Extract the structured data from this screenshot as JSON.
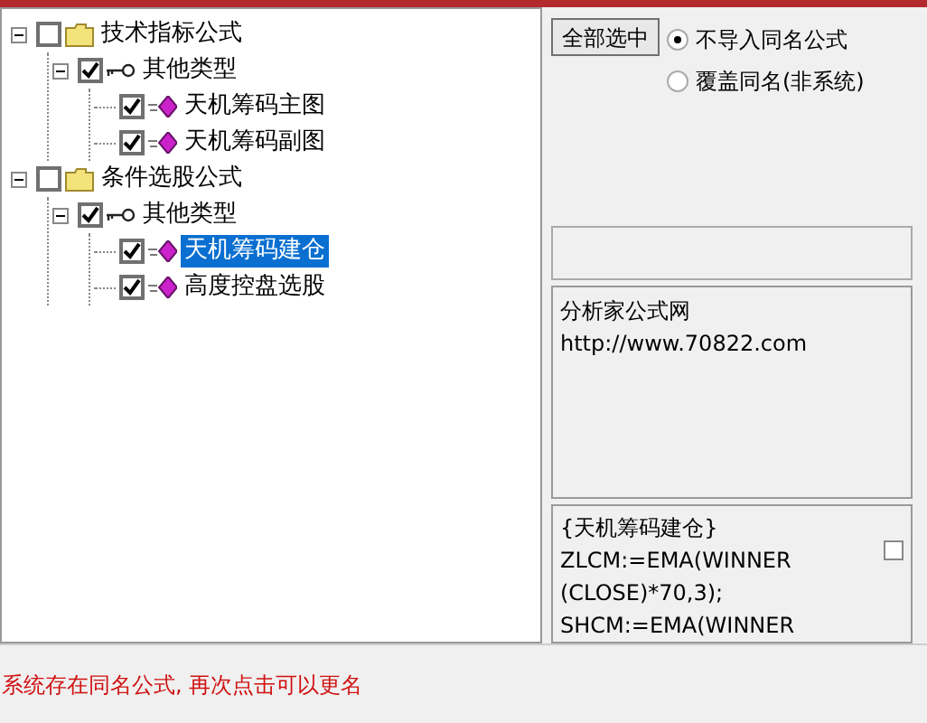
{
  "tree": [
    {
      "kind": "folder",
      "label": "技术指标公式",
      "checked": false,
      "selected": false,
      "expanded": true,
      "children": [
        {
          "kind": "group",
          "label": "其他类型",
          "checked": true,
          "selected": false,
          "expanded": true,
          "children": [
            {
              "kind": "formula",
              "label": "天机筹码主图",
              "checked": true,
              "selected": false
            },
            {
              "kind": "formula",
              "label": "天机筹码副图",
              "checked": true,
              "selected": false
            }
          ]
        }
      ]
    },
    {
      "kind": "folder",
      "label": "条件选股公式",
      "checked": false,
      "selected": false,
      "expanded": true,
      "children": [
        {
          "kind": "group",
          "label": "其他类型",
          "checked": true,
          "selected": false,
          "expanded": true,
          "children": [
            {
              "kind": "formula",
              "label": "天机筹码建仓",
              "checked": true,
              "selected": true
            },
            {
              "kind": "formula",
              "label": "高度控盘选股",
              "checked": true,
              "selected": false
            }
          ]
        }
      ]
    }
  ],
  "select_all_button": "全部选中",
  "import_options": [
    {
      "label": "不导入同名公式",
      "selected": true
    },
    {
      "label": "覆盖同名(非系统)",
      "selected": false
    }
  ],
  "info_box": [
    "分析家公式网",
    "http://www.70822.com"
  ],
  "formula_box": {
    "lines": [
      "{天机筹码建仓}",
      "ZLCM:=EMA(WINNER",
      "(CLOSE)*70,3);",
      "SHCM:=EMA(WINNER"
    ],
    "checked": false
  },
  "status_message": "系统存在同名公式, 再次点击可以更名"
}
